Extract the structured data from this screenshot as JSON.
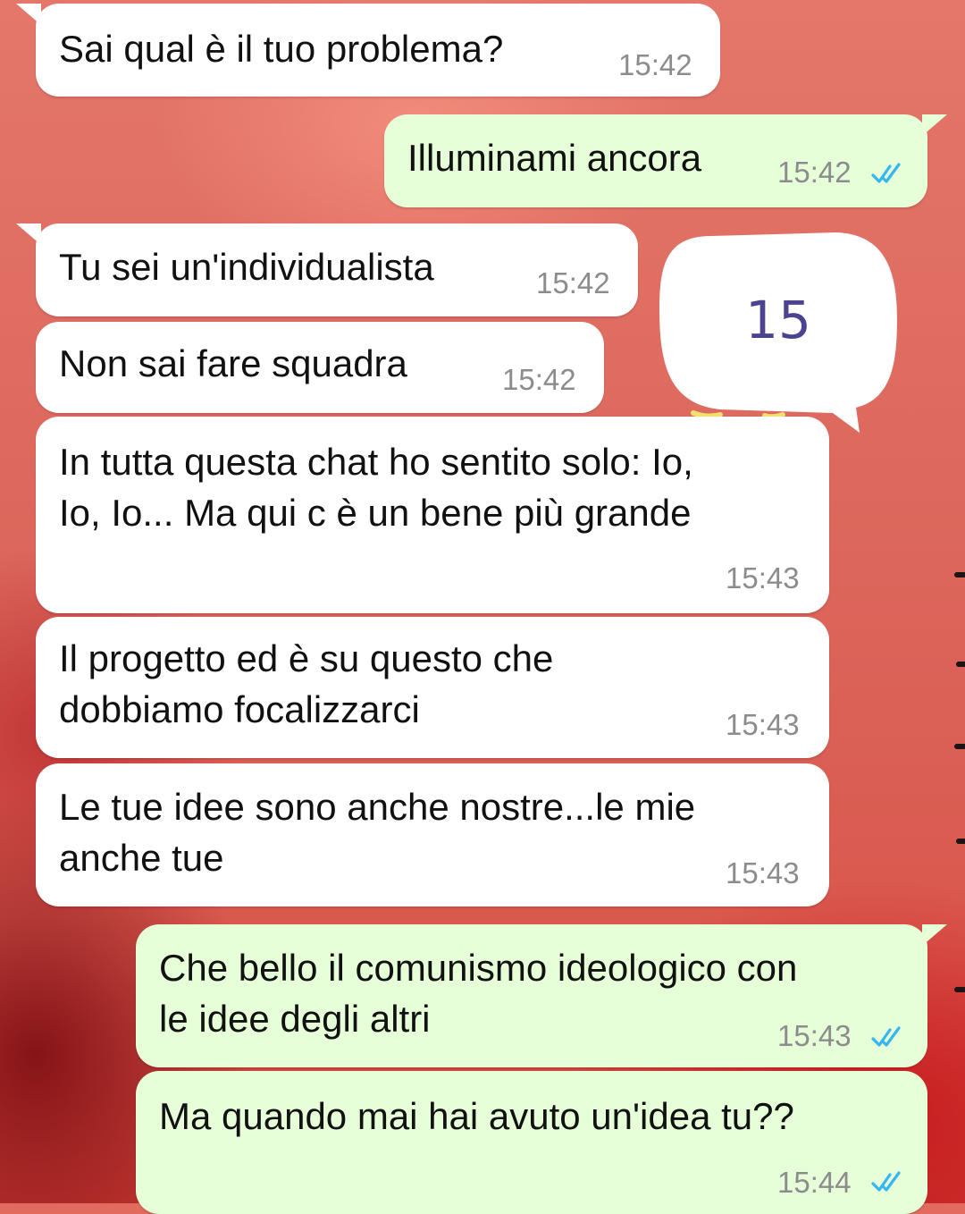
{
  "chat": {
    "messages": [
      {
        "direction": "incoming",
        "text": "Sai qual è il tuo problema?",
        "time": "15:42"
      },
      {
        "direction": "outgoing",
        "text": "Illuminami ancora",
        "time": "15:42",
        "status": "read"
      },
      {
        "direction": "incoming",
        "text": "Tu sei un'individualista",
        "time": "15:42"
      },
      {
        "direction": "incoming",
        "text": "Non sai fare squadra",
        "time": "15:42"
      },
      {
        "direction": "incoming",
        "text": "In tutta questa chat ho sentito solo: Io,\nIo, Io... Ma qui c è un bene più grande",
        "time": "15:43"
      },
      {
        "direction": "incoming",
        "text": "Il progetto ed è su questo che\ndobbiamo focalizzarci",
        "time": "15:43"
      },
      {
        "direction": "incoming",
        "text": "Le tue idee sono anche nostre...le mie\nanche tue",
        "time": "15:43"
      },
      {
        "direction": "outgoing",
        "text": "Che bello il comunismo ideologico con\nle idee degli altri",
        "time": "15:43",
        "status": "read"
      },
      {
        "direction": "outgoing",
        "text": "Ma quando mai hai avuto un'idea tu??",
        "time": "15:44",
        "status": "read"
      }
    ]
  },
  "overlay": {
    "speech_bubble_number": "15"
  },
  "icons": {
    "read_receipt": "double-check-icon",
    "speech_bubble": "speech-bubble-icon"
  },
  "colors": {
    "incoming_bubble": "#ffffff",
    "outgoing_bubble": "#e6ffd8",
    "read_receipt": "#34b7f1",
    "timestamp": "#8c8c8c",
    "sticker_number": "#4b4290",
    "wallpaper": "#e06b5e"
  }
}
